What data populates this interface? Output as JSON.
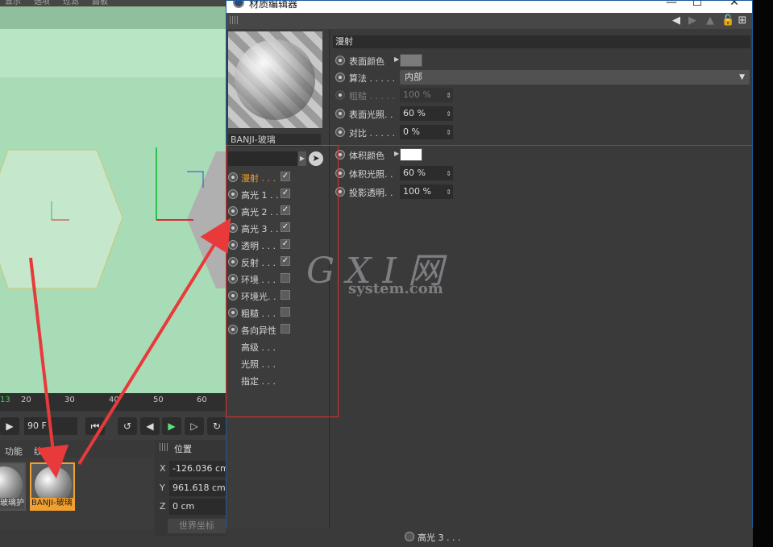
{
  "background_app": {
    "menu": [
      "显示",
      "选项",
      "过滤",
      "面板"
    ],
    "timeline_ticks": [
      "13",
      "20",
      "30",
      "40",
      "50",
      "60"
    ],
    "frame_field": "90 F",
    "material_tabs": [
      "功能",
      "纹理"
    ],
    "material_thumbs": [
      {
        "label": "-玻璃护"
      },
      {
        "label": "BANJI-玻璃"
      }
    ],
    "coord_panel": {
      "title": "位置",
      "rows": [
        {
          "axis": "X",
          "value": "-126.036 cm"
        },
        {
          "axis": "Y",
          "value": "961.618 cm"
        },
        {
          "axis": "Z",
          "value": "0 cm"
        }
      ],
      "mode_button": "世界坐标"
    },
    "below_window_item": {
      "label": "高光 3 . . ."
    }
  },
  "window": {
    "title": "材质编辑器",
    "min": "—",
    "max": "☐",
    "close": "✕"
  },
  "material": {
    "name": "BANJI-玻璃",
    "channels": [
      {
        "label": "漫射 . . .",
        "checked": true,
        "active": true
      },
      {
        "label": "高光 1 . .",
        "checked": true
      },
      {
        "label": "高光 2 . .",
        "checked": true
      },
      {
        "label": "高光 3 . .",
        "checked": true
      },
      {
        "label": "透明 . . .",
        "checked": true
      },
      {
        "label": "反射 . . .",
        "checked": true
      },
      {
        "label": "环境 . . .",
        "checked": false
      },
      {
        "label": "环境光. .",
        "checked": false
      },
      {
        "label": "粗糙 . . .",
        "checked": false
      },
      {
        "label": "各向异性",
        "checked": false
      }
    ],
    "extra_items": [
      "高级 . . .",
      "光照 . . .",
      "指定 . . ."
    ]
  },
  "properties": {
    "section": "漫射",
    "surface_color_label": "表面颜色",
    "surface_color": "#7b7b7b",
    "algorithm_label": "算法 . . . . .",
    "algorithm_value": "内部",
    "roughness_label": "粗糙 . . . . .",
    "roughness_value": "100 %",
    "surface_light_label": "表面光照. .",
    "surface_light_value": "60 %",
    "contrast_label": "对比 . . . . .",
    "contrast_value": "0 %",
    "volume_color_label": "体积颜色",
    "volume_color": "#ffffff",
    "volume_light_label": "体积光照. .",
    "volume_light_value": "60 %",
    "shadow_trans_label": "投影透明. .",
    "shadow_trans_value": "100 %"
  },
  "watermark": {
    "big": "G X I 网",
    "small": "system.com"
  },
  "colors": {
    "accent": "#f0a030",
    "highlight_box": "#e03030",
    "arrow": "#e83a3a"
  }
}
